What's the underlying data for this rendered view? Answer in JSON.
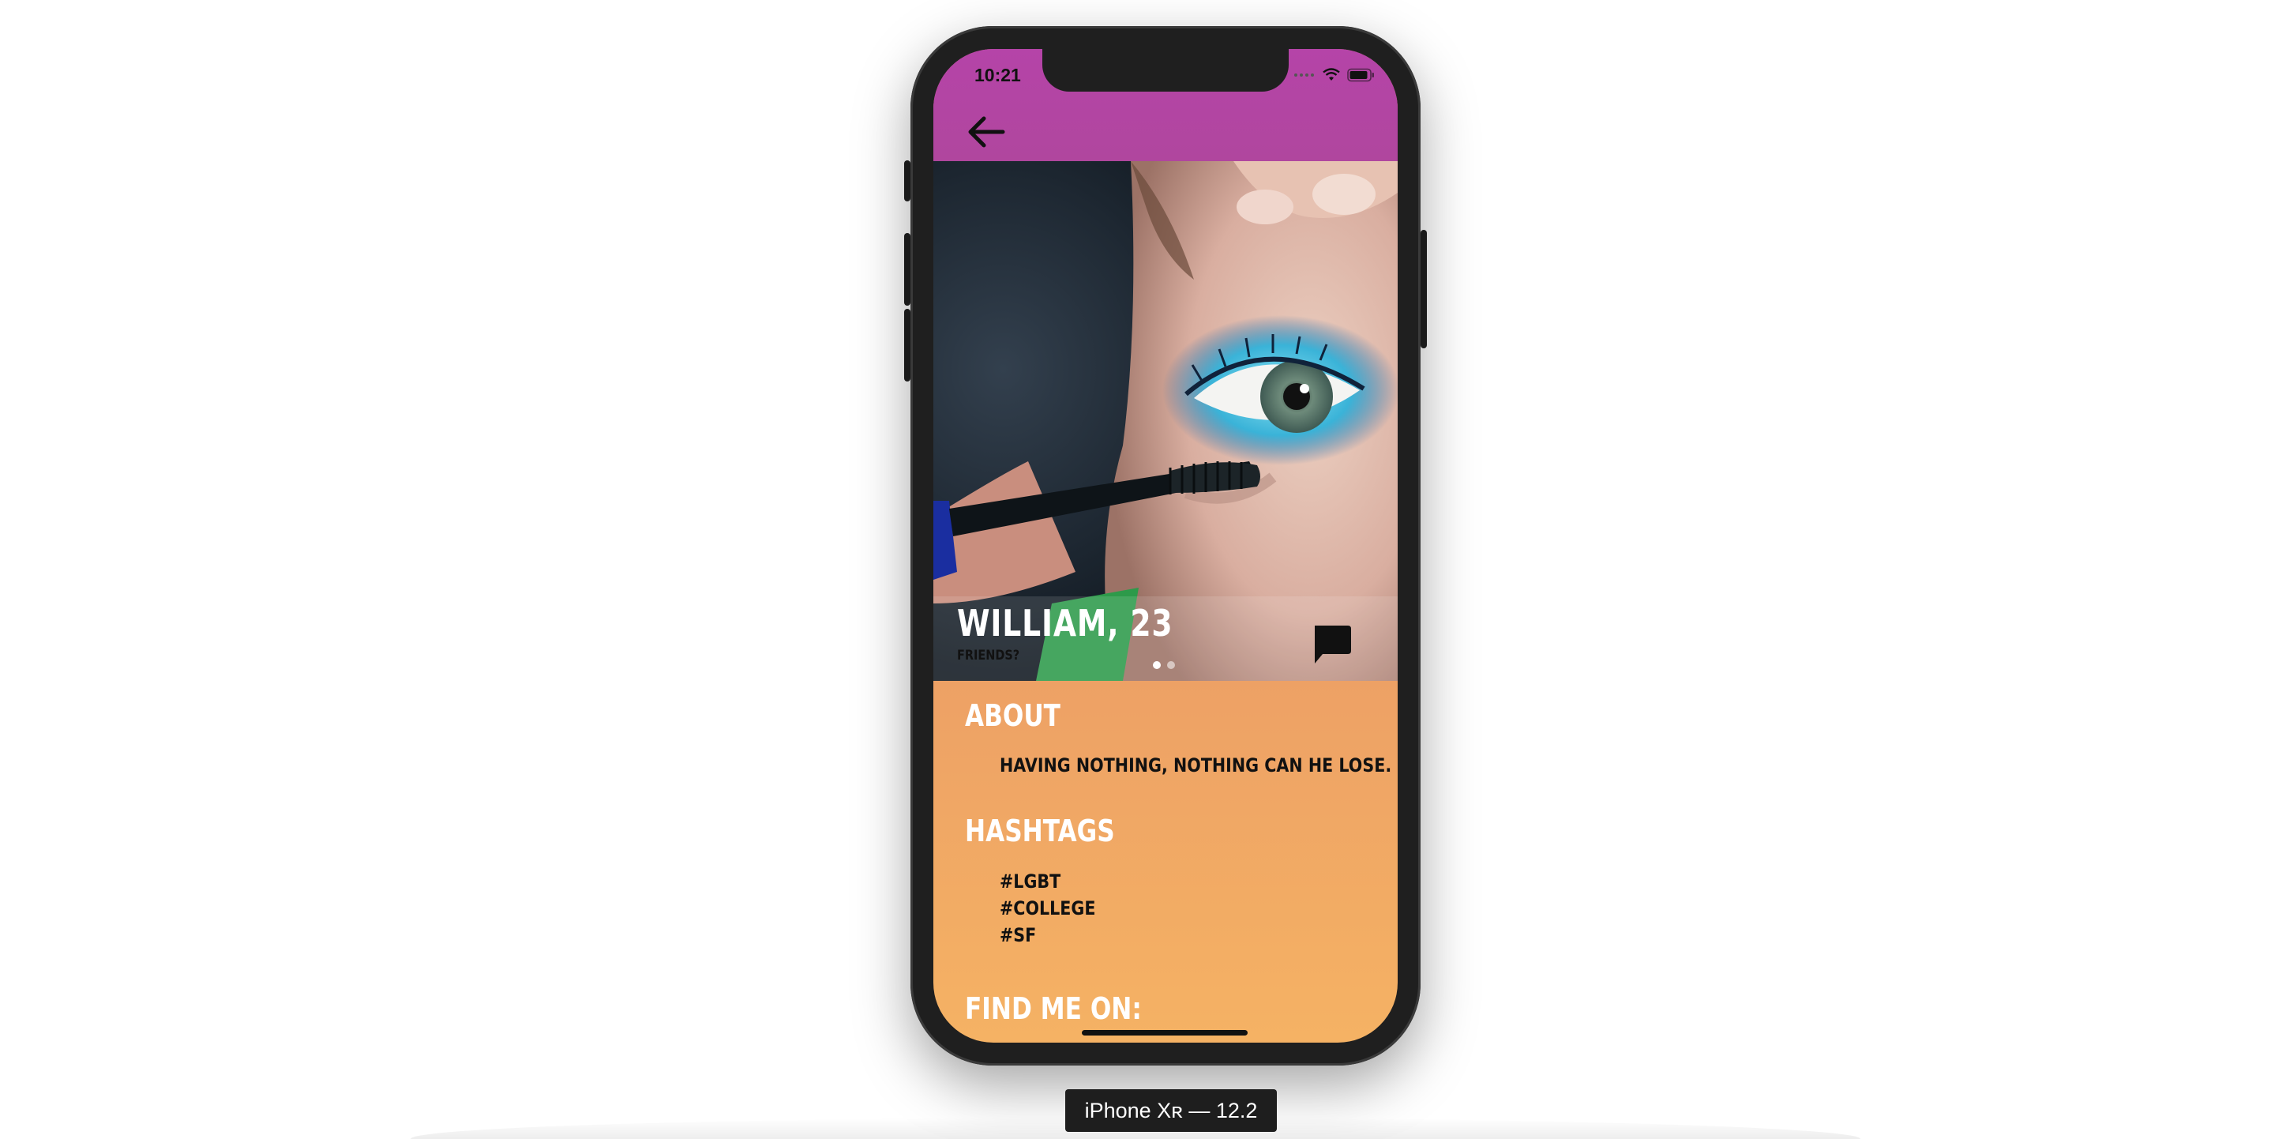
{
  "device_label": "iPhone Xʀ — 12.2",
  "status_bar": {
    "time": "10:21",
    "icons": [
      "cellular-dots-icon",
      "wifi-icon",
      "battery-icon"
    ]
  },
  "header": {
    "back_icon": "arrow-left-icon",
    "background_color": "#b0449f"
  },
  "profile": {
    "photo_icon": "profile-photo-eye-makeup",
    "name": "WILLIAM, 23",
    "status": "FRIENDS?",
    "photo_count": 2,
    "active_photo": 1,
    "chat_icon": "chat-bubble-icon"
  },
  "about": {
    "title": "ABOUT",
    "text": "HAVING NOTHING, NOTHING CAN HE LOSE."
  },
  "hashtags": {
    "title": "HASHTAGS",
    "items": [
      "#LGBT",
      "#COLLEGE",
      "#SF"
    ]
  },
  "find_me": {
    "title": "FIND ME ON:"
  },
  "colors": {
    "gradient_top": "#e0817a",
    "gradient_bottom": "#f5b264",
    "header": "#b0449f"
  }
}
